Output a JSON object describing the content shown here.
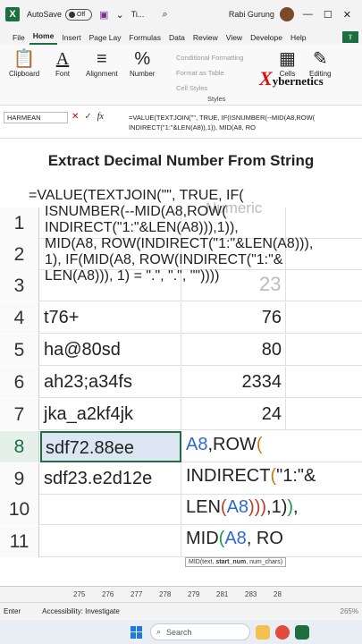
{
  "titlebar": {
    "autosave_label": "AutoSave",
    "autosave_state": "Off",
    "doc_title": "Ti...",
    "user_name": "Rabi Gurung"
  },
  "ribbon_tabs": [
    "File",
    "Home",
    "Insert",
    "Page Lay",
    "Formulas",
    "Data",
    "Review",
    "View",
    "Develope",
    "Help"
  ],
  "ribbon": {
    "clipboard": "Clipboard",
    "font": "Font",
    "alignment": "Alignment",
    "number": "Number",
    "conditional_formatting": "Conditional Formatting",
    "format_as_table": "Format as Table",
    "cell_styles": "Cell Styles",
    "styles": "Styles",
    "cells": "Cells",
    "editing": "Editing",
    "brand": "ybernetics"
  },
  "formula_bar": {
    "name_box": "HARMEAN",
    "formula": "=VALUE(TEXTJOIN(\"\", TRUE, IF(ISNUMBER(--MID(A8,ROW( INDIRECT(\"1:\"&LEN(A8)),1)), MID(A8, RO"
  },
  "overlay": {
    "title": "Extract Decimal Number From String",
    "formula_lines": [
      "=VALUE(TEXTJOIN(\"\", TRUE, IF(",
      "ISNUMBER(--MID(A8,ROW(",
      "INDIRECT(\"1:\"&LEN(A8))),1)),",
      "MID(A8, ROW(INDIRECT(\"1:\"&LEN(A8))),",
      "1), IF(MID(A8, ROW(INDIRECT(\"1:\"&",
      "LEN(A8))), 1) = \".\", \".\", \"\"))))"
    ]
  },
  "grid": {
    "ghost_header": "Numeric",
    "ghost_value": "23",
    "rows": [
      {
        "num": "1",
        "a": "",
        "b": ""
      },
      {
        "num": "2",
        "a": "",
        "b": ""
      },
      {
        "num": "3",
        "a": "",
        "b": ""
      },
      {
        "num": "4",
        "a": "t76+",
        "b": "76"
      },
      {
        "num": "5",
        "a": "ha@80sd",
        "b": "80"
      },
      {
        "num": "6",
        "a": "ah23;a34fs",
        "b": "2334"
      },
      {
        "num": "7",
        "a": "jka_a2kf4jk",
        "b": "24"
      },
      {
        "num": "8",
        "a": "sdf72.88ee",
        "b": ""
      },
      {
        "num": "9",
        "a": "sdf23.e2d12e",
        "b": ""
      },
      {
        "num": "10",
        "a": "",
        "b": ""
      },
      {
        "num": "11",
        "a": "",
        "b": ""
      }
    ]
  },
  "edit_cell": {
    "line1": [
      "A8",
      ",ROW",
      "("
    ],
    "line2": [
      "INDIRECT",
      "(",
      "\"1:\"&"
    ],
    "line3": [
      "LEN",
      "(",
      "A8",
      ")))",
      ",1)",
      ")",
      ","
    ],
    "line4": [
      "MID",
      "(",
      "A8",
      ", RO"
    ]
  },
  "tooltip": {
    "fn": "MID(text, ",
    "bold": "start_num",
    "rest": ", num_chars)"
  },
  "column_ruler": [
    "275",
    "276",
    "277",
    "278",
    "279",
    "281",
    "283",
    "28"
  ],
  "status": {
    "mode": "Enter",
    "accessibility": "Accessibility: Investigate",
    "zoom": "265%"
  },
  "taskbar": {
    "search_placeholder": "Search"
  }
}
